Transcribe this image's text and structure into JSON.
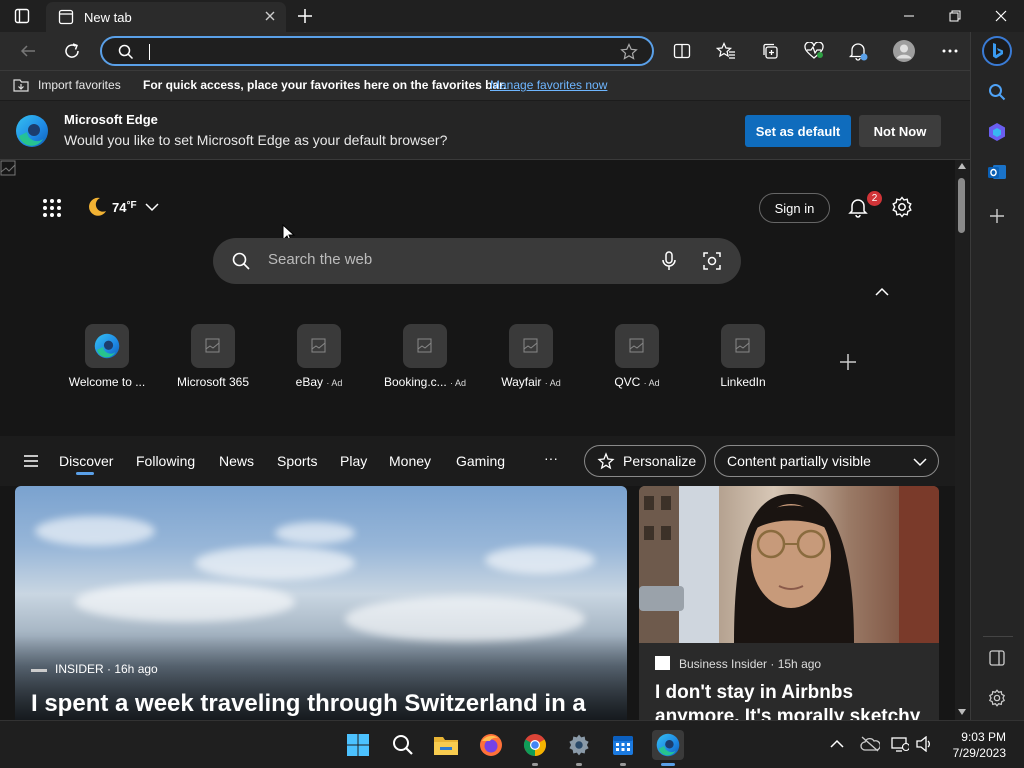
{
  "browser": {
    "tab_title": "New tab",
    "address_value": "",
    "favorites_bar": {
      "import_label": "Import favorites",
      "quick_access_text": "For quick access, place your favorites here on the favorites bar.",
      "manage_link": "Manage favorites now"
    },
    "default_prompt": {
      "title": "Microsoft Edge",
      "message": "Would you like to set Microsoft Edge as your default browser?",
      "set_default_label": "Set as default",
      "not_now_label": "Not Now"
    }
  },
  "newtab": {
    "weather": {
      "temp": "74",
      "unit": "°F"
    },
    "sign_in_label": "Sign in",
    "notification_count": "2",
    "search_placeholder": "Search the web",
    "quick_links": [
      {
        "label": "Welcome to ...",
        "ad": ""
      },
      {
        "label": "Microsoft 365",
        "ad": ""
      },
      {
        "label": "eBay",
        "ad": "· Ad"
      },
      {
        "label": "Booking.c...",
        "ad": "· Ad"
      },
      {
        "label": "Wayfair",
        "ad": "· Ad"
      },
      {
        "label": "QVC",
        "ad": "· Ad"
      },
      {
        "label": "LinkedIn",
        "ad": ""
      }
    ],
    "feed_nav": [
      "Discover",
      "Following",
      "News",
      "Sports",
      "Play",
      "Money",
      "Gaming"
    ],
    "more_label": "···",
    "personalize_label": "Personalize",
    "content_visibility": "Content partially visible",
    "cards": [
      {
        "source": "INSIDER · 16h ago",
        "headline": "I spent a week traveling through Switzerland in a"
      },
      {
        "source": "Business Insider · 15h ago",
        "headline": "I don't stay in Airbnbs anymore. It's morally sketchy"
      }
    ]
  },
  "taskbar": {
    "time": "9:03 PM",
    "date": "7/29/2023"
  },
  "colors": {
    "accent": "#0f6cbd",
    "focus_ring": "#5aa0e8",
    "badge": "#d13438"
  }
}
